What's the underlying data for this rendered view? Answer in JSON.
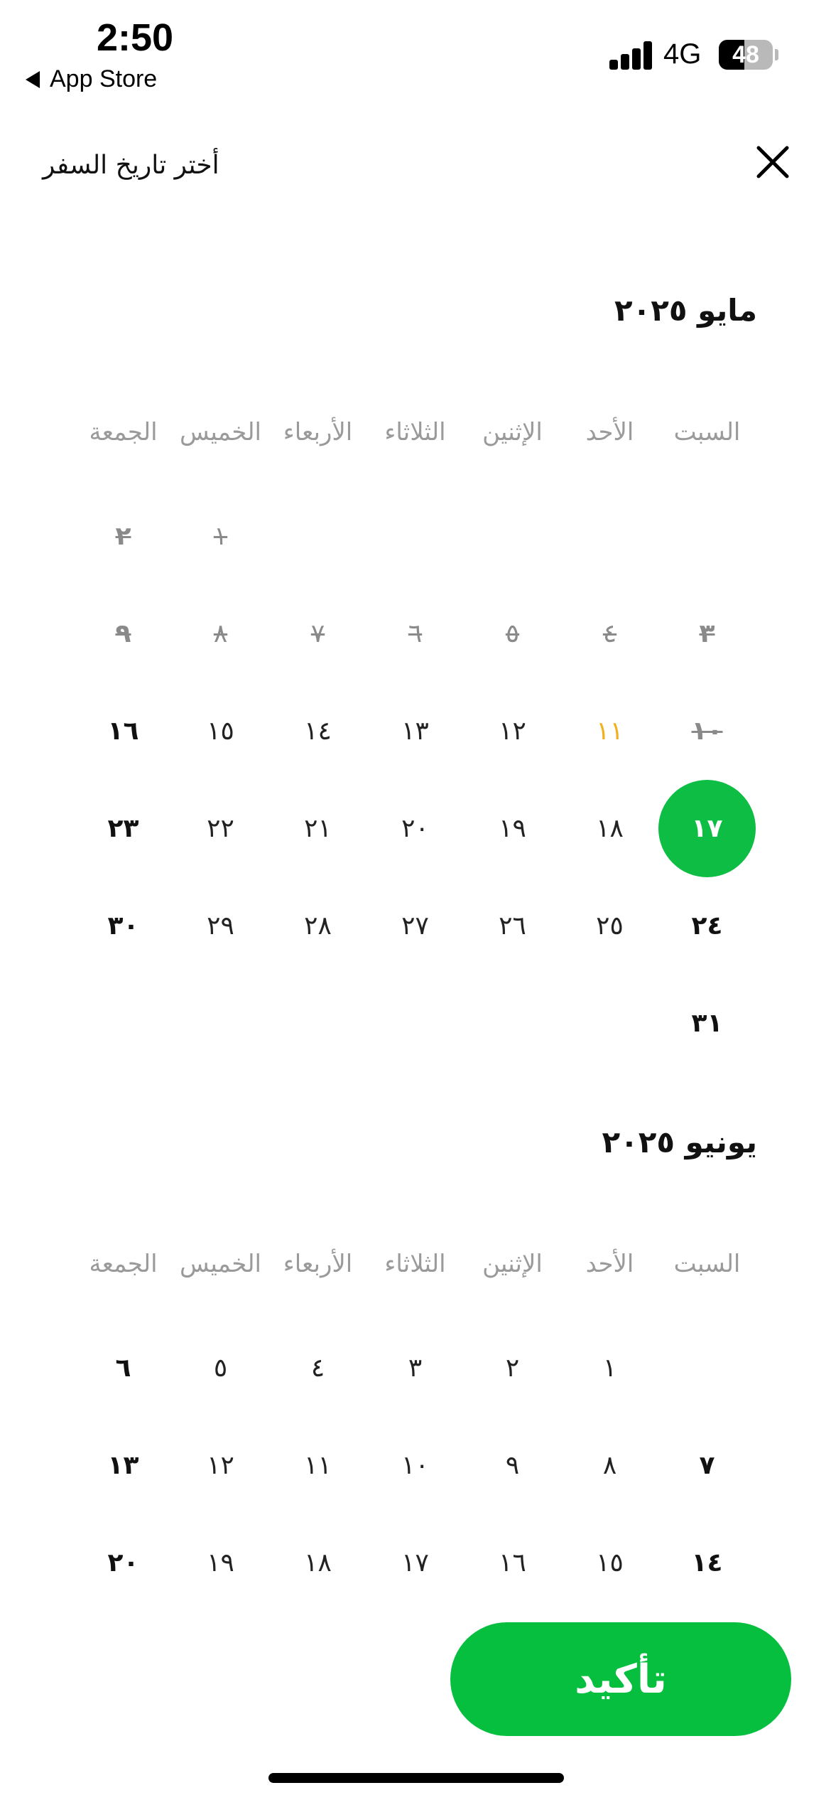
{
  "status_bar": {
    "time": "2:50",
    "back_label": "App Store",
    "network": "4G",
    "battery": "48",
    "battery_level": 0.48
  },
  "header": {
    "title": "أختر تاريخ السفر",
    "close_icon": "close-icon"
  },
  "months": [
    {
      "title": "مايو ٢٠٢٥",
      "weekdays": [
        "السبت",
        "الأحد",
        "الإثنين",
        "الثلاثاء",
        "الأربعاء",
        "الخميس",
        "الجمعة"
      ],
      "weeks": [
        [
          null,
          null,
          null,
          null,
          null,
          {
            "label": "١",
            "state": "past"
          },
          {
            "label": "٢",
            "state": "past"
          }
        ],
        [
          {
            "label": "٣",
            "state": "past"
          },
          {
            "label": "٤",
            "state": "past"
          },
          {
            "label": "٥",
            "state": "past"
          },
          {
            "label": "٦",
            "state": "past"
          },
          {
            "label": "٧",
            "state": "past"
          },
          {
            "label": "٨",
            "state": "past"
          },
          {
            "label": "٩",
            "state": "past"
          }
        ],
        [
          {
            "label": "١٠",
            "state": "past"
          },
          {
            "label": "١١",
            "state": "today"
          },
          {
            "label": "١٢",
            "state": "normal"
          },
          {
            "label": "١٣",
            "state": "normal"
          },
          {
            "label": "١٤",
            "state": "normal"
          },
          {
            "label": "١٥",
            "state": "normal"
          },
          {
            "label": "١٦",
            "state": "normal"
          }
        ],
        [
          {
            "label": "١٧",
            "state": "selected"
          },
          {
            "label": "١٨",
            "state": "normal"
          },
          {
            "label": "١٩",
            "state": "normal"
          },
          {
            "label": "٢٠",
            "state": "normal"
          },
          {
            "label": "٢١",
            "state": "normal"
          },
          {
            "label": "٢٢",
            "state": "normal"
          },
          {
            "label": "٢٣",
            "state": "normal"
          }
        ],
        [
          {
            "label": "٢٤",
            "state": "normal"
          },
          {
            "label": "٢٥",
            "state": "normal"
          },
          {
            "label": "٢٦",
            "state": "normal"
          },
          {
            "label": "٢٧",
            "state": "normal"
          },
          {
            "label": "٢٨",
            "state": "normal"
          },
          {
            "label": "٢٩",
            "state": "normal"
          },
          {
            "label": "٣٠",
            "state": "normal"
          }
        ],
        [
          {
            "label": "٣١",
            "state": "normal"
          },
          null,
          null,
          null,
          null,
          null,
          null
        ]
      ]
    },
    {
      "title": "يونيو ٢٠٢٥",
      "weekdays": [
        "السبت",
        "الأحد",
        "الإثنين",
        "الثلاثاء",
        "الأربعاء",
        "الخميس",
        "الجمعة"
      ],
      "weeks": [
        [
          null,
          {
            "label": "١",
            "state": "normal"
          },
          {
            "label": "٢",
            "state": "normal"
          },
          {
            "label": "٣",
            "state": "normal"
          },
          {
            "label": "٤",
            "state": "normal"
          },
          {
            "label": "٥",
            "state": "normal"
          },
          {
            "label": "٦",
            "state": "normal"
          }
        ],
        [
          {
            "label": "٧",
            "state": "normal"
          },
          {
            "label": "٨",
            "state": "normal"
          },
          {
            "label": "٩",
            "state": "normal"
          },
          {
            "label": "١٠",
            "state": "normal"
          },
          {
            "label": "١١",
            "state": "normal"
          },
          {
            "label": "١٢",
            "state": "normal"
          },
          {
            "label": "١٣",
            "state": "normal"
          }
        ],
        [
          {
            "label": "١٤",
            "state": "normal"
          },
          {
            "label": "١٥",
            "state": "normal"
          },
          {
            "label": "١٦",
            "state": "normal"
          },
          {
            "label": "١٧",
            "state": "normal"
          },
          {
            "label": "١٨",
            "state": "normal"
          },
          {
            "label": "١٩",
            "state": "normal"
          },
          {
            "label": "٢٠",
            "state": "normal"
          }
        ]
      ]
    }
  ],
  "confirm_label": "تأكيد",
  "colors": {
    "accent": "#06bf3f",
    "today": "#f2b01e",
    "muted": "#9a9a9a"
  }
}
